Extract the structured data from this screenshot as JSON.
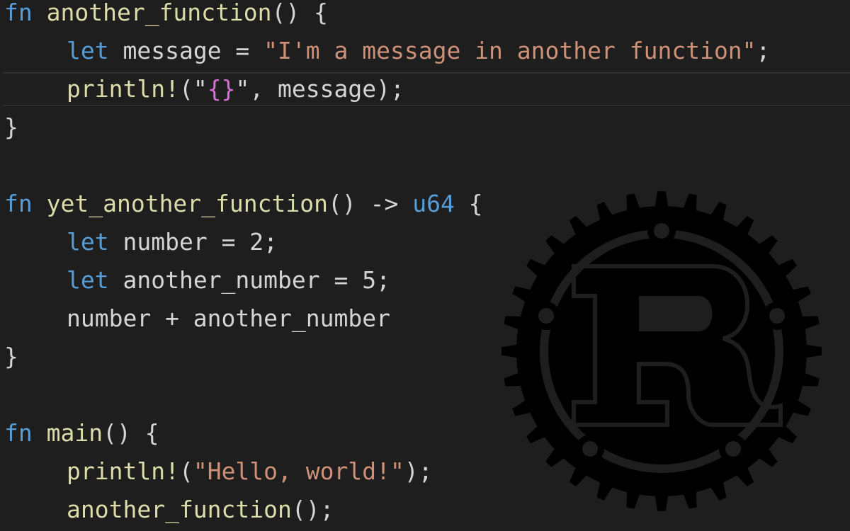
{
  "editor": {
    "lines": [
      {
        "kw": "fn",
        "name": "another_function",
        "rest": "() {"
      },
      {
        "kw": "let",
        "name": "message",
        "mid": " = ",
        "str": "\"I'm a message in another function\"",
        "end": ";"
      },
      {
        "mac": "println!",
        "open": "(\"",
        "fmt": "{}",
        "close": "\", message);"
      },
      {
        "text": "}"
      },
      {
        "text": ""
      },
      {
        "kw": "fn",
        "name": "yet_another_function",
        "rest": "() -> ",
        "type": "u64",
        "end": " {"
      },
      {
        "kw": "let",
        "name": "number",
        "rest": " = 2;"
      },
      {
        "kw": "let",
        "name": "another_number",
        "rest": " = 5;"
      },
      {
        "text": "number + another_number"
      },
      {
        "text": "}"
      },
      {
        "text": ""
      },
      {
        "kw": "fn",
        "name": "main",
        "rest": "() {"
      },
      {
        "mac": "println!",
        "open": "(",
        "str": "\"Hello, world!\"",
        "close": ");"
      },
      {
        "call": "another_function",
        "rest": "();"
      }
    ]
  },
  "logo": {
    "icon": "rust-logo-icon",
    "letter": "R",
    "color": "#000000"
  },
  "colors": {
    "background": "#1e1e1e",
    "keyword": "#569cd6",
    "function": "#dcdcaa",
    "string": "#ce9178",
    "default": "#d4d4d4"
  }
}
